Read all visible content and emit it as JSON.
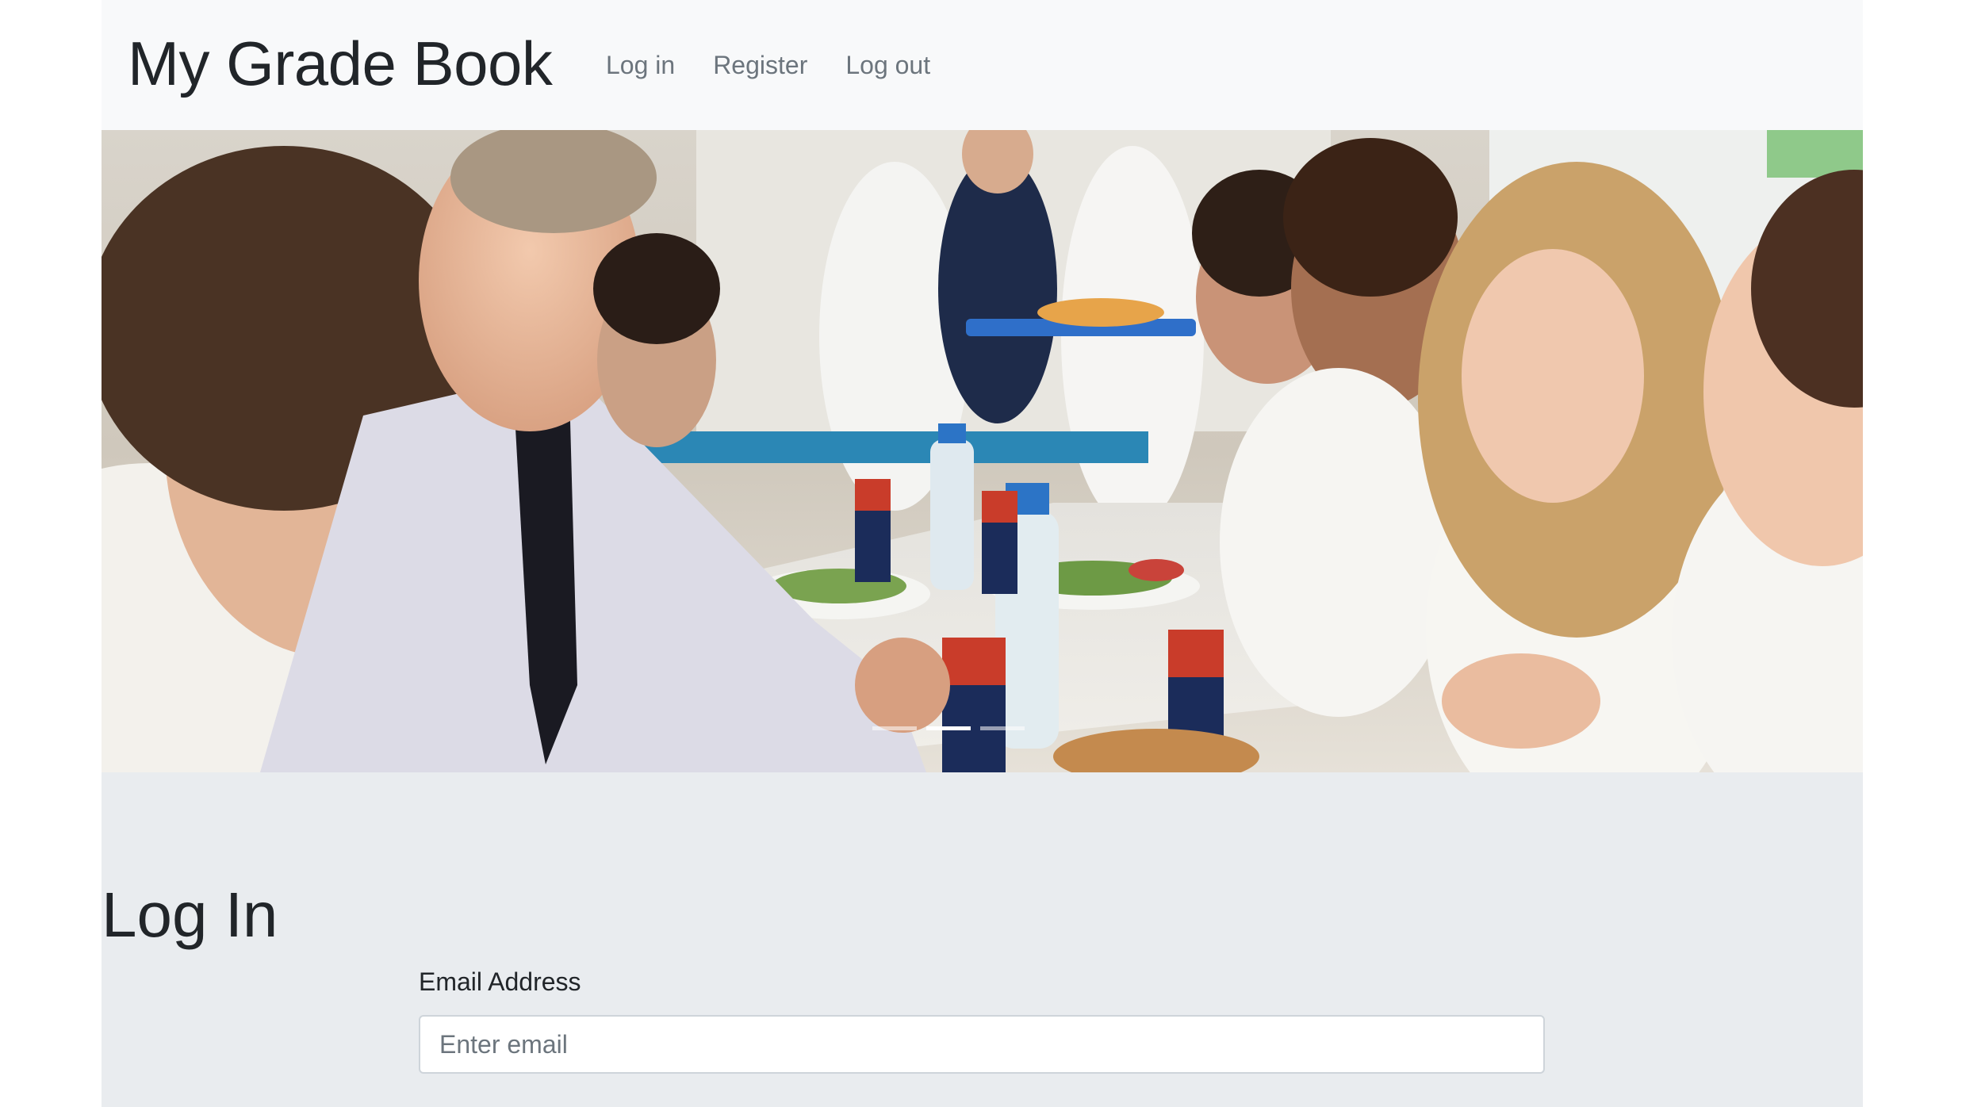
{
  "navbar": {
    "brand": "My Grade Book",
    "links": [
      {
        "label": "Log in"
      },
      {
        "label": "Register"
      },
      {
        "label": "Log out"
      }
    ]
  },
  "carousel": {
    "image_description": "teacher-and-students-eating-lunch-photo",
    "slide_count": 3,
    "active_slide": 2
  },
  "login": {
    "title": "Log In",
    "email_label": "Email Address",
    "email_placeholder": "Enter email",
    "email_value": ""
  },
  "colors": {
    "navbar_bg": "#f8f9fa",
    "jumbotron_bg": "#e9ecef",
    "text_dark": "#212529",
    "nav_link": "#6c757d"
  }
}
